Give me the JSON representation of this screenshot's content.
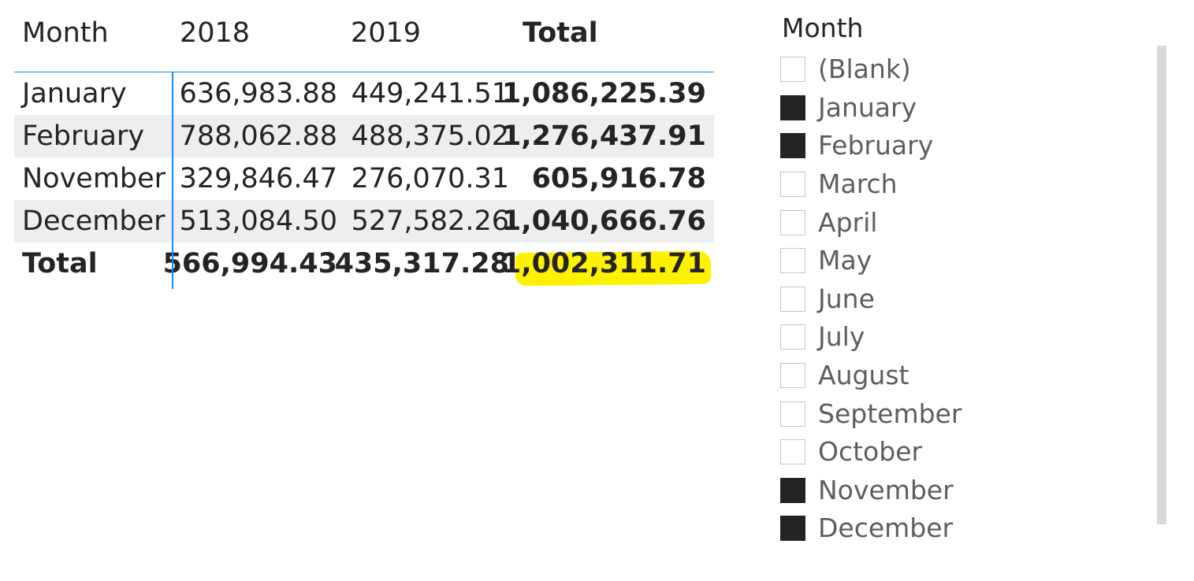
{
  "matrix": {
    "headers": {
      "month": "Month",
      "y2018": "2018",
      "y2019": "2019",
      "total": "Total"
    },
    "rows": [
      {
        "month": "January",
        "y2018": "636,983.88",
        "y2019": "449,241.51",
        "total": "1,086,225.39"
      },
      {
        "month": "February",
        "y2018": "788,062.88",
        "y2019": "488,375.02",
        "total": "1,276,437.91"
      },
      {
        "month": "November",
        "y2018": "329,846.47",
        "y2019": "276,070.31",
        "total": "605,916.78"
      },
      {
        "month": "December",
        "y2018": "513,084.50",
        "y2019": "527,582.26",
        "total": "1,040,666.76"
      }
    ],
    "total_row": {
      "label": "Total",
      "y2018": "566,994.43",
      "y2019": "435,317.28",
      "total": "1,002,311.71"
    },
    "highlight_color": "#fff200",
    "accent_color": "#118dff"
  },
  "slicer": {
    "title": "Month",
    "items": [
      {
        "label": "(Blank)",
        "checked": false
      },
      {
        "label": "January",
        "checked": true
      },
      {
        "label": "February",
        "checked": true
      },
      {
        "label": "March",
        "checked": false
      },
      {
        "label": "April",
        "checked": false
      },
      {
        "label": "May",
        "checked": false
      },
      {
        "label": "June",
        "checked": false
      },
      {
        "label": "July",
        "checked": false
      },
      {
        "label": "August",
        "checked": false
      },
      {
        "label": "September",
        "checked": false
      },
      {
        "label": "October",
        "checked": false
      },
      {
        "label": "November",
        "checked": true
      },
      {
        "label": "December",
        "checked": true
      }
    ]
  }
}
